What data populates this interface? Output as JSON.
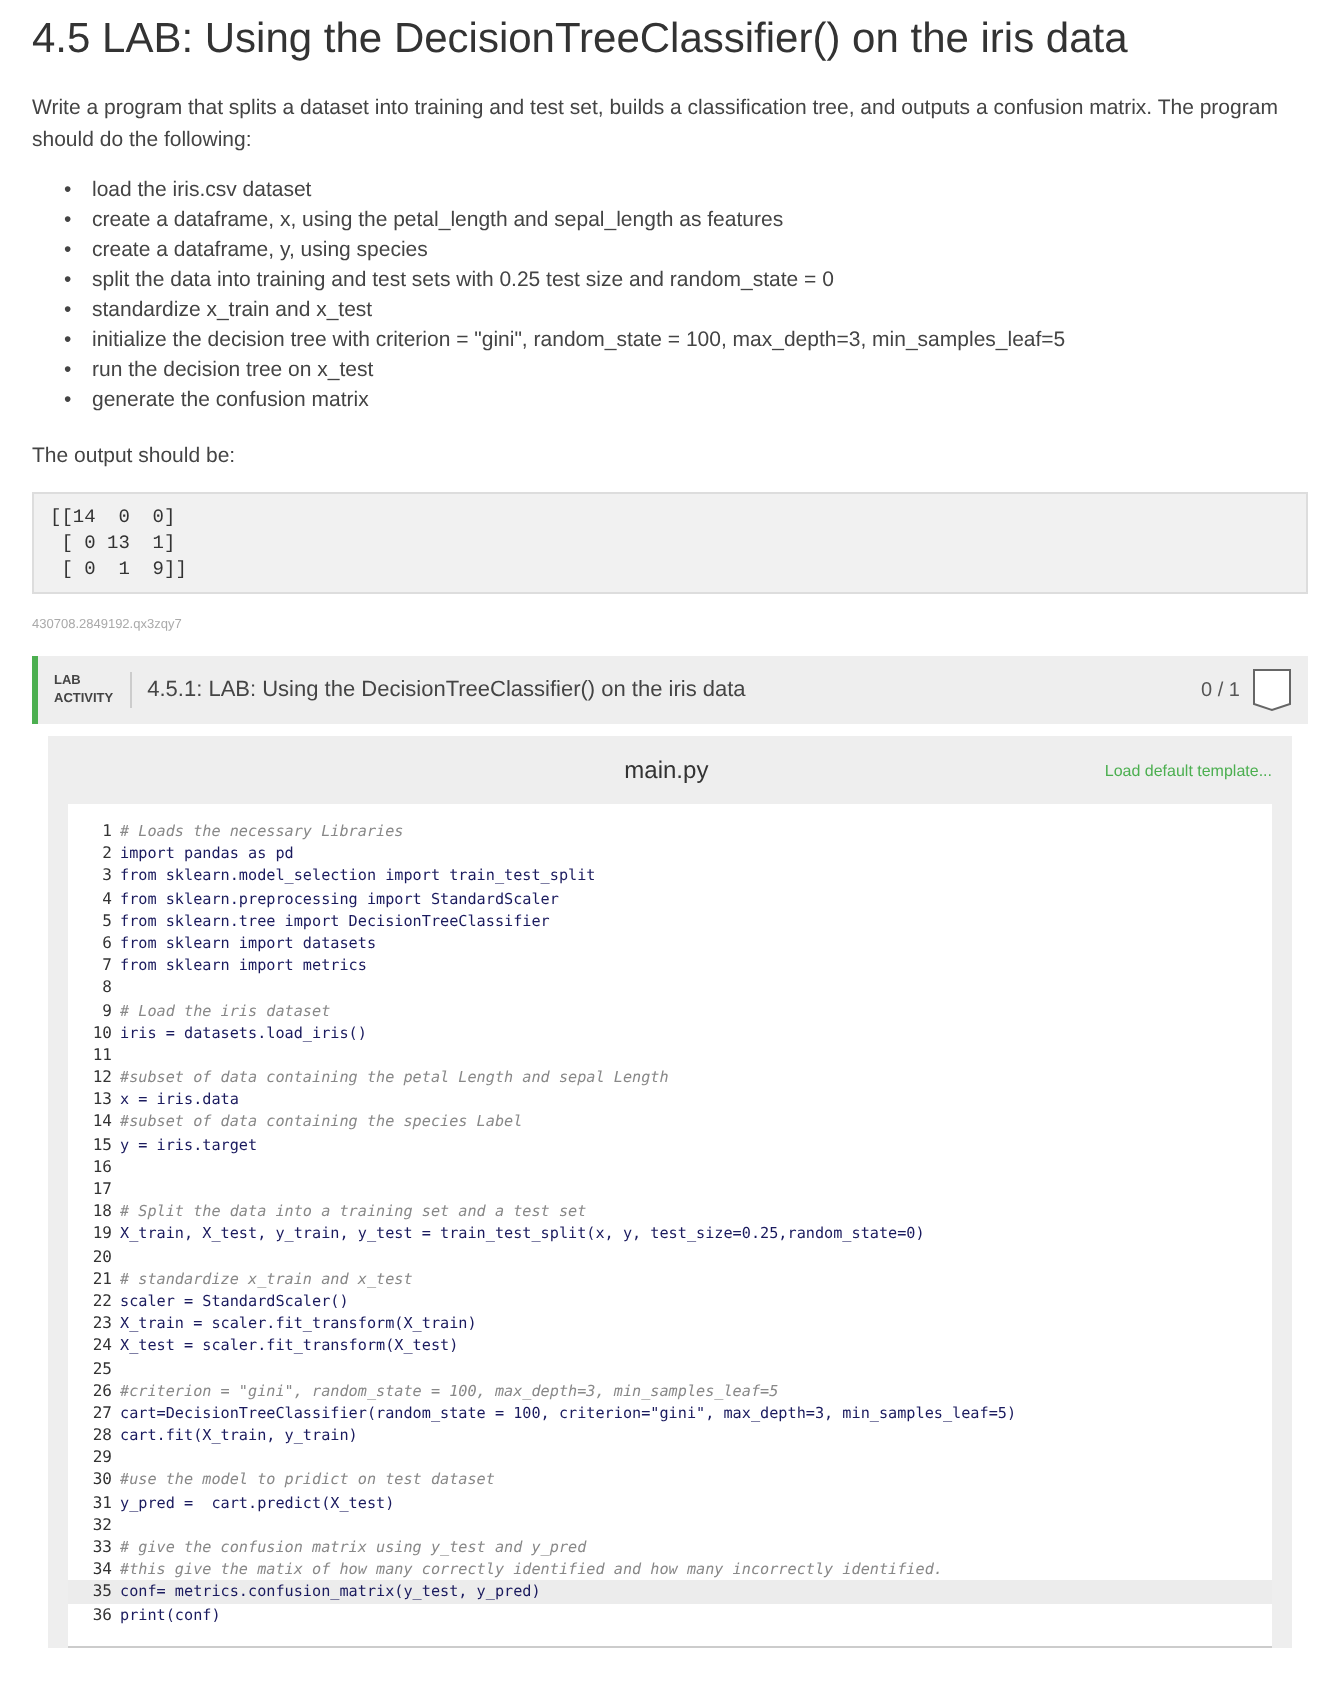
{
  "title": "4.5 LAB: Using the DecisionTreeClassifier() on the iris data",
  "intro": "Write a program that splits a dataset into training and test set, builds a classification tree, and outputs a confusion matrix. The program should do the following:",
  "steps": [
    {
      "bullet": "•",
      "text": "load the iris.csv dataset"
    },
    {
      "bullet": "•",
      "text": "create a dataframe, x, using the petal_length and sepal_length as features"
    },
    {
      "bullet": "•",
      "text": "create a dataframe, y, using species"
    },
    {
      "bullet": "•",
      "text": "split the data into training and test sets with 0.25 test size and random_state = 0"
    },
    {
      "bullet": "•",
      "text": "standardize x_train and x_test"
    },
    {
      "bullet": "•",
      "text": "initialize the decision tree with criterion = \"gini\", random_state = 100, max_depth=3, min_samples_leaf=5"
    },
    {
      "bullet": "•",
      "text": "run the decision tree on x_test"
    },
    {
      "bullet": "•",
      "text": "generate the confusion matrix"
    }
  ],
  "output_label": "The output should be:",
  "output": [
    "[[14  0  0]",
    " [ 0 13  1]",
    " [ 0  1  9]]"
  ],
  "code_id": "430708.2849192.qx3zqy7",
  "activity": {
    "tag": "LAB\nACTIVITY",
    "title": "4.5.1: LAB: Using the DecisionTreeClassifier() on the iris data",
    "score": "0 / 1"
  },
  "editor": {
    "filename": "main.py",
    "template_link": "Load default template...",
    "lines": [
      {
        "no": "1",
        "text": "# Loads the necessary Libraries",
        "kind": "comment",
        "selected": false
      },
      {
        "no": "2",
        "text": "import pandas as pd",
        "kind": "code",
        "selected": false
      },
      {
        "no": "3",
        "text": "from sklearn.model_selection import train_test_split",
        "kind": "code",
        "selected": false
      },
      {
        "no": "4",
        "text": "from sklearn.preprocessing import StandardScaler",
        "kind": "code",
        "selected": false
      },
      {
        "no": "5",
        "text": "from sklearn.tree import DecisionTreeClassifier",
        "kind": "code",
        "selected": false
      },
      {
        "no": "6",
        "text": "from sklearn import datasets",
        "kind": "code",
        "selected": false
      },
      {
        "no": "7",
        "text": "from sklearn import metrics",
        "kind": "code",
        "selected": false
      },
      {
        "no": "8",
        "selected": false
      },
      {
        "no": "9",
        "text": "# Load the iris dataset",
        "kind": "comment",
        "selected": false
      },
      {
        "no": "10",
        "text": "iris = datasets.load_iris()",
        "kind": "code",
        "selected": false
      },
      {
        "no": "11",
        "selected": false
      },
      {
        "no": "12",
        "text": "#subset of data containing the petal Length and sepal Length",
        "kind": "comment",
        "selected": false
      },
      {
        "no": "13",
        "text": "x = iris.data",
        "kind": "code",
        "selected": false
      },
      {
        "no": "14",
        "text": "#subset of data containing the species Label",
        "kind": "comment",
        "selected": false
      },
      {
        "no": "15",
        "text": "y = iris.target",
        "kind": "code",
        "selected": false
      },
      {
        "no": "16",
        "selected": false
      },
      {
        "no": "17",
        "selected": false
      },
      {
        "no": "18",
        "text": "# Split the data into a training set and a test set",
        "kind": "comment",
        "selected": false
      },
      {
        "no": "19",
        "text": "X_train, X_test, y_train, y_test = train_test_split(x, y, test_size=0.25,random_state=0)",
        "kind": "code",
        "selected": false
      },
      {
        "no": "20",
        "selected": false
      },
      {
        "no": "21",
        "text": "# standardize x_train and x_test",
        "kind": "comment",
        "selected": false
      },
      {
        "no": "22",
        "text": "scaler = StandardScaler()",
        "kind": "code",
        "selected": false
      },
      {
        "no": "23",
        "text": "X_train = scaler.fit_transform(X_train)",
        "kind": "code",
        "selected": false
      },
      {
        "no": "24",
        "text": "X_test = scaler.fit_transform(X_test)",
        "kind": "code",
        "selected": false
      },
      {
        "no": "25",
        "selected": false
      },
      {
        "no": "26",
        "text": "#criterion = \"gini\", random_state = 100, max_depth=3, min_samples_leaf=5",
        "kind": "comment",
        "selected": false
      },
      {
        "no": "27",
        "text": "cart=DecisionTreeClassifier(random_state = 100, criterion=\"gini\", max_depth=3, min_samples_leaf=5)",
        "kind": "code",
        "selected": false
      },
      {
        "no": "28",
        "text": "cart.fit(X_train, y_train)",
        "kind": "code",
        "selected": false
      },
      {
        "no": "29",
        "selected": false
      },
      {
        "no": "30",
        "text": "#use the model to pridict on test dataset",
        "kind": "comment",
        "selected": false
      },
      {
        "no": "31",
        "text": "y_pred =  cart.predict(X_test)",
        "kind": "code",
        "selected": false
      },
      {
        "no": "32",
        "selected": false
      },
      {
        "no": "33",
        "text": "# give the confusion matrix using y_test and y_pred",
        "kind": "comment",
        "selected": false
      },
      {
        "no": "34",
        "text": "#this give the matix of how many correctly identified and how many incorrectly identified.",
        "kind": "comment",
        "selected": false
      },
      {
        "no": "35",
        "text": "conf= metrics.confusion_matrix(y_test, y_pred)",
        "kind": "code",
        "selected": true
      },
      {
        "no": "36",
        "text": "print(conf)",
        "kind": "code",
        "selected": false
      }
    ]
  }
}
